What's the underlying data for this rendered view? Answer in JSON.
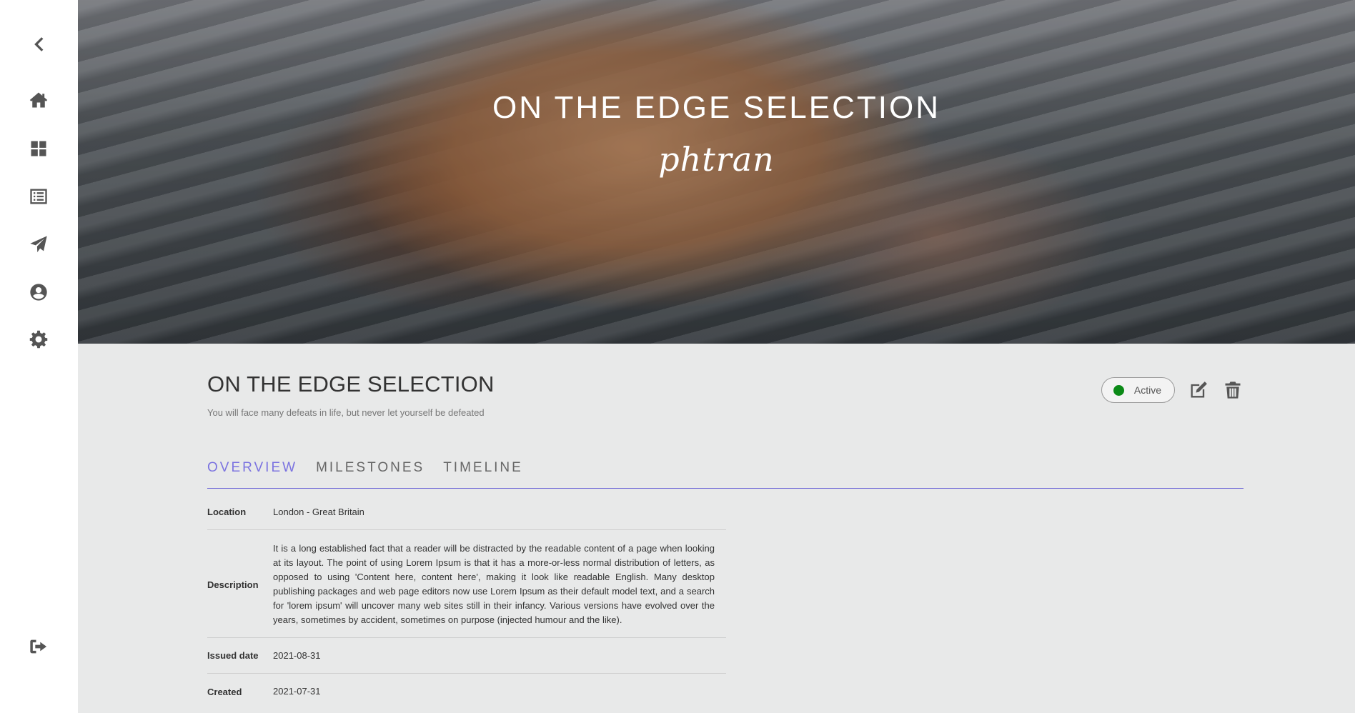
{
  "sidebar": {
    "items": [
      {
        "name": "back",
        "icon": "chevron-left-icon"
      },
      {
        "name": "home",
        "icon": "home-icon"
      },
      {
        "name": "dashboard",
        "icon": "grid-icon"
      },
      {
        "name": "list",
        "icon": "list-icon"
      },
      {
        "name": "send",
        "icon": "paper-plane-icon"
      },
      {
        "name": "profile",
        "icon": "user-circle-icon"
      },
      {
        "name": "settings",
        "icon": "gear-icon"
      },
      {
        "name": "logout",
        "icon": "sign-out-icon"
      }
    ]
  },
  "hero": {
    "title": "ON THE EDGE SELECTION",
    "signature": "phtran"
  },
  "project": {
    "title": "ON THE EDGE SELECTION",
    "subtitle": "You will face many defeats in life, but never let yourself be defeated",
    "status": {
      "label": "Active",
      "color": "#0b8a17"
    }
  },
  "tabs": [
    {
      "label": "OVERVIEW",
      "active": true
    },
    {
      "label": "MILESTONES",
      "active": false
    },
    {
      "label": "TIMELINE",
      "active": false
    }
  ],
  "details": {
    "location": {
      "label": "Location",
      "value": "London - Great Britain"
    },
    "description": {
      "label": "Description",
      "value": "It is a long established fact that a reader will be distracted by the readable content of a page when looking at its layout. The point of using Lorem Ipsum is that it has a more-or-less normal distribution of letters, as opposed to using 'Content here, content here', making it look like readable English. Many desktop publishing packages and web page editors now use Lorem Ipsum as their default model text, and a search for 'lorem ipsum' will uncover many web sites still in their infancy. Various versions have evolved over the years, sometimes by accident, sometimes on purpose (injected humour and the like)."
    },
    "issued": {
      "label": "Issued date",
      "value": "2021-08-31"
    },
    "created": {
      "label": "Created",
      "value": "2021-07-31"
    }
  },
  "colors": {
    "accent": "#7b73e0",
    "tab_underline": "#6a62d6",
    "background": "#e8e9e9"
  }
}
